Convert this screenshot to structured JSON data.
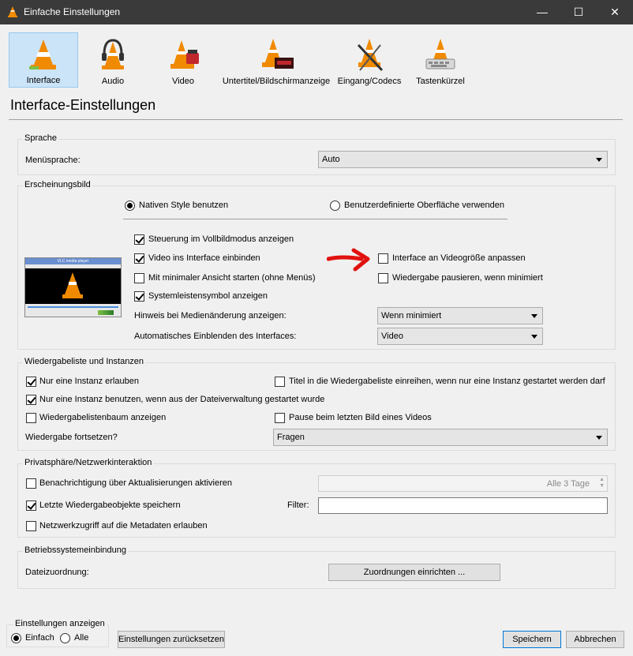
{
  "window": {
    "title": "Einfache Einstellungen",
    "controls": {
      "minimize": "—",
      "maximize": "☐",
      "close": "✕"
    }
  },
  "toolbar": {
    "items": [
      {
        "label": "Interface",
        "icon": "interface-cone-icon",
        "selected": true
      },
      {
        "label": "Audio",
        "icon": "audio-headphones-cone-icon"
      },
      {
        "label": "Video",
        "icon": "video-cone-icon"
      },
      {
        "label": "Untertitel/Bildschirmanzeige",
        "icon": "subtitles-cone-icon"
      },
      {
        "label": "Eingang/Codecs",
        "icon": "codecs-cone-icon"
      },
      {
        "label": "Tastenkürzel",
        "icon": "hotkeys-cone-icon"
      }
    ]
  },
  "page_title": "Interface-Einstellungen",
  "sprache": {
    "title": "Sprache",
    "menu_label": "Menüsprache:",
    "menu_value": "Auto"
  },
  "erscheinung": {
    "title": "Erscheinungsbild",
    "radio_native": "Nativen Style benutzen",
    "radio_custom": "Benutzerdefinierte Oberfläche verwenden",
    "cb_fullscreen": "Steuerung im Vollbildmodus anzeigen",
    "cb_embed": "Video ins Interface einbinden",
    "cb_minimal": "Mit minimaler Ansicht starten (ohne Menüs)",
    "cb_systray": "Systemleistensymbol anzeigen",
    "cb_resize": "Interface an Videogröße anpassen",
    "cb_pause": "Wiedergabe pausieren, wenn minimiert",
    "notify_label": "Hinweis bei Medienänderung anzeigen:",
    "notify_value": "Wenn minimiert",
    "autoraise_label": "Automatisches Einblenden des Interfaces:",
    "autoraise_value": "Video",
    "preview_title": "VLC media player"
  },
  "wiedergabe": {
    "title": "Wiedergabeliste und Instanzen",
    "cb_multi": "Nur eine Instanz erlauben",
    "cb_enqueue": "Titel in die Wiedergabeliste einreihen, wenn nur eine Instanz gestartet werden darf",
    "cb_filemgr": "Nur eine Instanz benutzen, wenn aus der Dateiverwaltung gestartet wurde",
    "cb_tree": "Wiedergabelistenbaum anzeigen",
    "cb_lastframe": "Pause beim letzten Bild eines Videos",
    "continue_label": "Wiedergabe fortsetzen?",
    "continue_value": "Fragen"
  },
  "privat": {
    "title": "Privatsphäre/Netzwerkinteraktion",
    "cb_updates": "Benachrichtigung über Aktualisierungen aktivieren",
    "update_interval": "Alle 3 Tage",
    "cb_recent": "Letzte Wiedergabeobjekte speichern",
    "filter_label": "Filter:",
    "filter_value": "",
    "cb_metadata": "Netzwerkzugriff auf die Metadaten erlauben"
  },
  "os": {
    "title": "Betriebssystemeinbindung",
    "assoc_label": "Dateizuordnung:",
    "assoc_button": "Zuordnungen einrichten ..."
  },
  "footer": {
    "show_title": "Einstellungen anzeigen",
    "radio_simple": "Einfach",
    "radio_all": "Alle",
    "reset_button": "Einstellungen zurücksetzen",
    "save_button": "Speichern",
    "cancel_button": "Abbrechen"
  },
  "colors": {
    "arrow": "#e0120f",
    "cone_orange": "#f08a00",
    "selected_bg": "#cce4f7",
    "titlebar": "#3a3a3a"
  }
}
